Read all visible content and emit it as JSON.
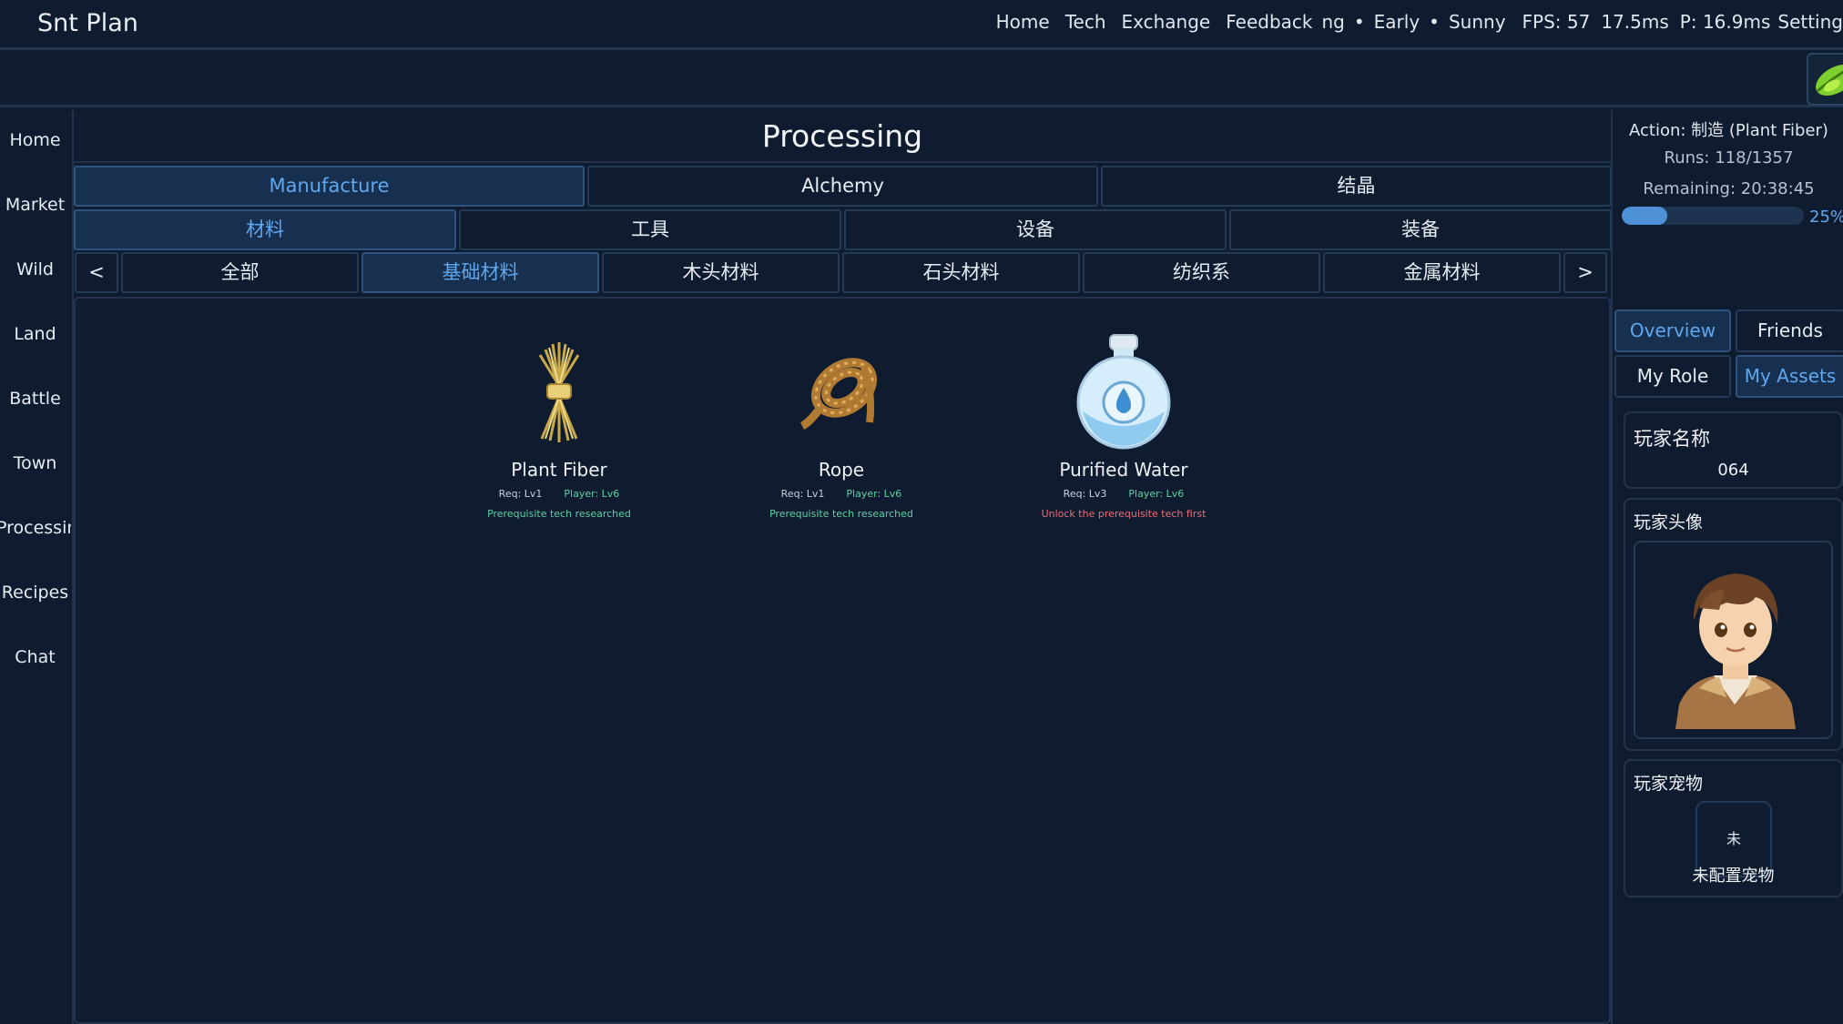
{
  "app": {
    "title": "Snt Plan"
  },
  "topnav": {
    "links": [
      "Home",
      "Tech",
      "Exchange",
      "Feedback"
    ],
    "season_fragment": "ng",
    "time_of_day": "Early",
    "weather": "Sunny",
    "fps": "FPS: 57",
    "frame_ms": "17.5ms",
    "p_ms": "P: 16.9ms",
    "settings_fragment": "Setting"
  },
  "sidebar": {
    "items": [
      "Home",
      "Market",
      "Wild",
      "Land",
      "Battle",
      "Town",
      "Processing",
      "Recipes",
      "Chat"
    ]
  },
  "main": {
    "title": "Processing",
    "tabs_row1": [
      {
        "label": "Manufacture",
        "active": true
      },
      {
        "label": "Alchemy",
        "active": false
      },
      {
        "label": "结晶",
        "active": false
      }
    ],
    "tabs_row2": [
      {
        "label": "材料",
        "active": true
      },
      {
        "label": "工具",
        "active": false
      },
      {
        "label": "设备",
        "active": false
      },
      {
        "label": "装备",
        "active": false
      }
    ],
    "tabs_row3": {
      "prev": "<",
      "next": ">",
      "items": [
        {
          "label": "全部",
          "active": false
        },
        {
          "label": "基础材料",
          "active": true
        },
        {
          "label": "木头材料",
          "active": false
        },
        {
          "label": "石头材料",
          "active": false
        },
        {
          "label": "纺织系",
          "active": false
        },
        {
          "label": "金属材料",
          "active": false
        }
      ]
    },
    "items": [
      {
        "name": "Plant Fiber",
        "icon": "plant-fiber-icon",
        "req": "Req: Lv1",
        "player": "Player: Lv6",
        "note": "Prerequisite tech researched",
        "unlocked": true
      },
      {
        "name": "Rope",
        "icon": "rope-icon",
        "req": "Req: Lv1",
        "player": "Player: Lv6",
        "note": "Prerequisite tech researched",
        "unlocked": true
      },
      {
        "name": "Purified Water",
        "icon": "purified-water-icon",
        "req": "Req: Lv3",
        "player": "Player: Lv6",
        "note": "Unlock the prerequisite tech first",
        "unlocked": false
      }
    ]
  },
  "right": {
    "action": "Action: 制造 (Plant Fiber)",
    "runs": "Runs: 118/1357",
    "remaining": "Remaining: 20:38:45",
    "progress_percent": 25,
    "progress_label": "25%",
    "tabs_row1": [
      {
        "label": "Overview",
        "active": true
      },
      {
        "label": "Friends",
        "active": false
      }
    ],
    "tabs_row2": [
      {
        "label": "My Role",
        "active": false
      },
      {
        "label": "My Assets",
        "active": true
      }
    ],
    "player_name_title": "玩家名称",
    "player_name_value": "064",
    "avatar_title": "玩家头像",
    "pet_title": "玩家宠物",
    "pet_placeholder": "未",
    "pet_status": "未配置宠物"
  },
  "colors": {
    "background": "#0f1b2e",
    "border": "#22344d",
    "accent": "#5fa7ef",
    "ok": "#5fd0a5",
    "error": "#ef6b78"
  }
}
